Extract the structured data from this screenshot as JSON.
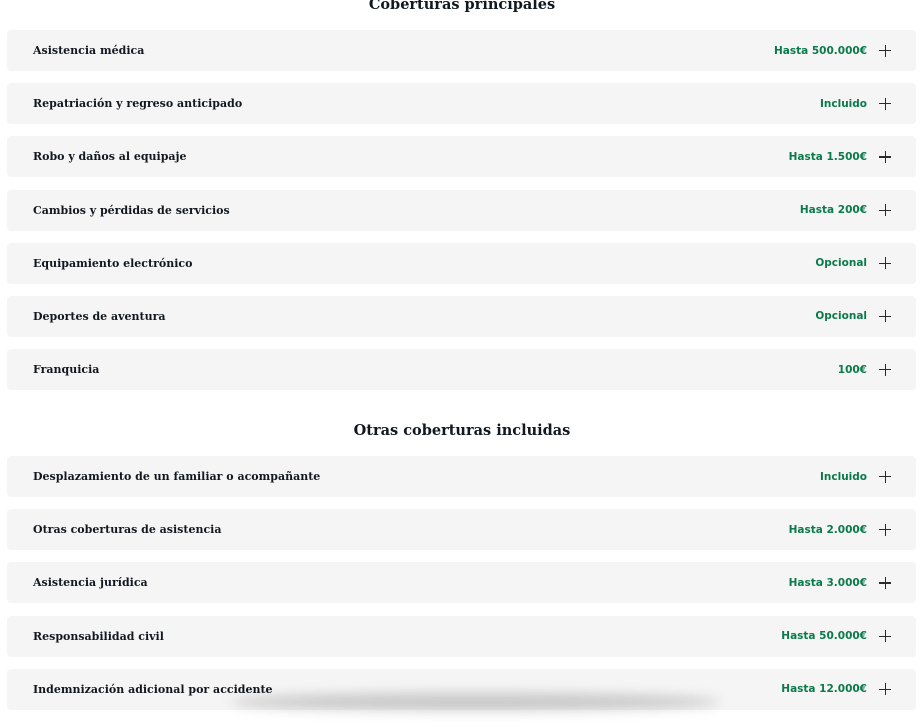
{
  "sections": {
    "principales": {
      "title": "Coberturas principales",
      "items": [
        {
          "label": "Asistencia médica",
          "value": "Hasta 500.000€"
        },
        {
          "label": "Repatriación y regreso anticipado",
          "value": "Incluido"
        },
        {
          "label": "Robo y daños al equipaje",
          "value": "Hasta 1.500€"
        },
        {
          "label": "Cambios y pérdidas de servicios",
          "value": "Hasta 200€"
        },
        {
          "label": "Equipamiento electrónico",
          "value": "Opcional"
        },
        {
          "label": "Deportes de aventura",
          "value": "Opcional"
        },
        {
          "label": "Franquicia",
          "value": "100€"
        }
      ]
    },
    "otras": {
      "title": "Otras coberturas incluidas",
      "items": [
        {
          "label": "Desplazamiento de un familiar o acompañante",
          "value": "Incluido"
        },
        {
          "label": "Otras coberturas de asistencia",
          "value": "Hasta 2.000€"
        },
        {
          "label": "Asistencia jurídica",
          "value": "Hasta 3.000€"
        },
        {
          "label": "Responsabilidad civil",
          "value": "Hasta 50.000€"
        },
        {
          "label": "Indemnización adicional por accidente",
          "value": "Hasta 12.000€"
        }
      ]
    }
  },
  "colors": {
    "accent": "#0b7a4b",
    "row_background": "#f5f5f5",
    "title_text": "#101820"
  },
  "icons": {
    "expand": "plus-icon"
  }
}
